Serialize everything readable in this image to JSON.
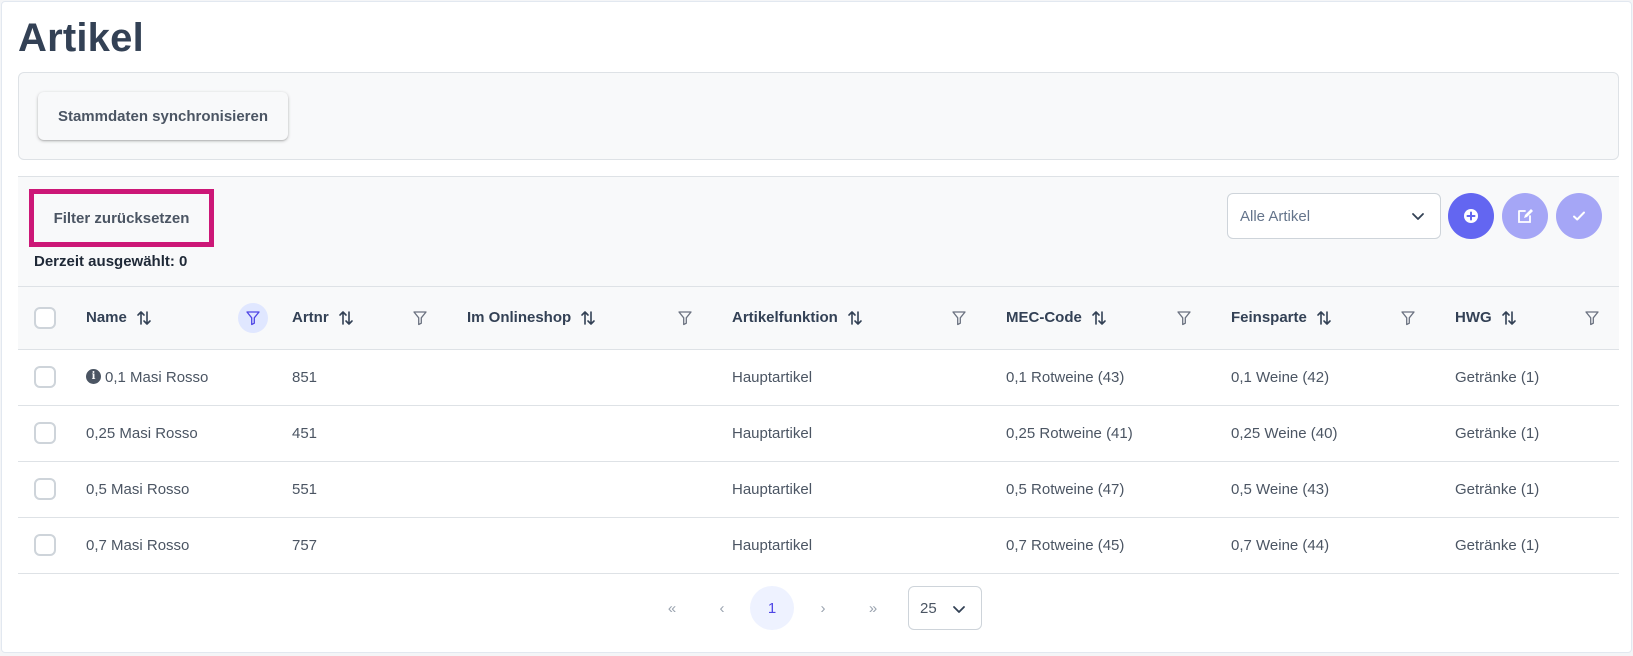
{
  "page": {
    "title": "Artikel"
  },
  "toolbar": {
    "sync_label": "Stammdaten synchronisieren"
  },
  "filters": {
    "reset_label": "Filter zurücksetzen",
    "selected_text": "Derzeit ausgewählt: 0",
    "article_select": {
      "value": "Alle Artikel"
    }
  },
  "colors": {
    "accent": "#6366f1",
    "accent_light": "#a5a6f6",
    "highlight": "#cc1777"
  },
  "table": {
    "columns": [
      {
        "label": "Name",
        "filter_active": true
      },
      {
        "label": "Artnr",
        "filter_active": false
      },
      {
        "label": "Im Onlineshop",
        "filter_active": false
      },
      {
        "label": "Artikelfunktion",
        "filter_active": false
      },
      {
        "label": "MEC-Code",
        "filter_active": false
      },
      {
        "label": "Feinsparte",
        "filter_active": false
      },
      {
        "label": "HWG",
        "filter_active": false
      }
    ],
    "rows": [
      {
        "has_info": true,
        "name": "0,1 Masi Rosso",
        "artnr": "851",
        "online": "",
        "function": "Hauptartikel",
        "mec": "0,1 Rotweine (43)",
        "feinsparte": "0,1 Weine (42)",
        "hwg": "Getränke (1)"
      },
      {
        "has_info": false,
        "name": "0,25 Masi Rosso",
        "artnr": "451",
        "online": "",
        "function": "Hauptartikel",
        "mec": "0,25 Rotweine (41)",
        "feinsparte": "0,25 Weine (40)",
        "hwg": "Getränke (1)"
      },
      {
        "has_info": false,
        "name": "0,5 Masi Rosso",
        "artnr": "551",
        "online": "",
        "function": "Hauptartikel",
        "mec": "0,5 Rotweine (47)",
        "feinsparte": "0,5 Weine (43)",
        "hwg": "Getränke (1)"
      },
      {
        "has_info": false,
        "name": "0,7 Masi Rosso",
        "artnr": "757",
        "online": "",
        "function": "Hauptartikel",
        "mec": "0,7 Rotweine (45)",
        "feinsparte": "0,7 Weine (44)",
        "hwg": "Getränke (1)"
      }
    ]
  },
  "pagination": {
    "first": "«",
    "prev": "‹",
    "current_page": "1",
    "next": "›",
    "last": "»",
    "rows_per_page": "25"
  }
}
